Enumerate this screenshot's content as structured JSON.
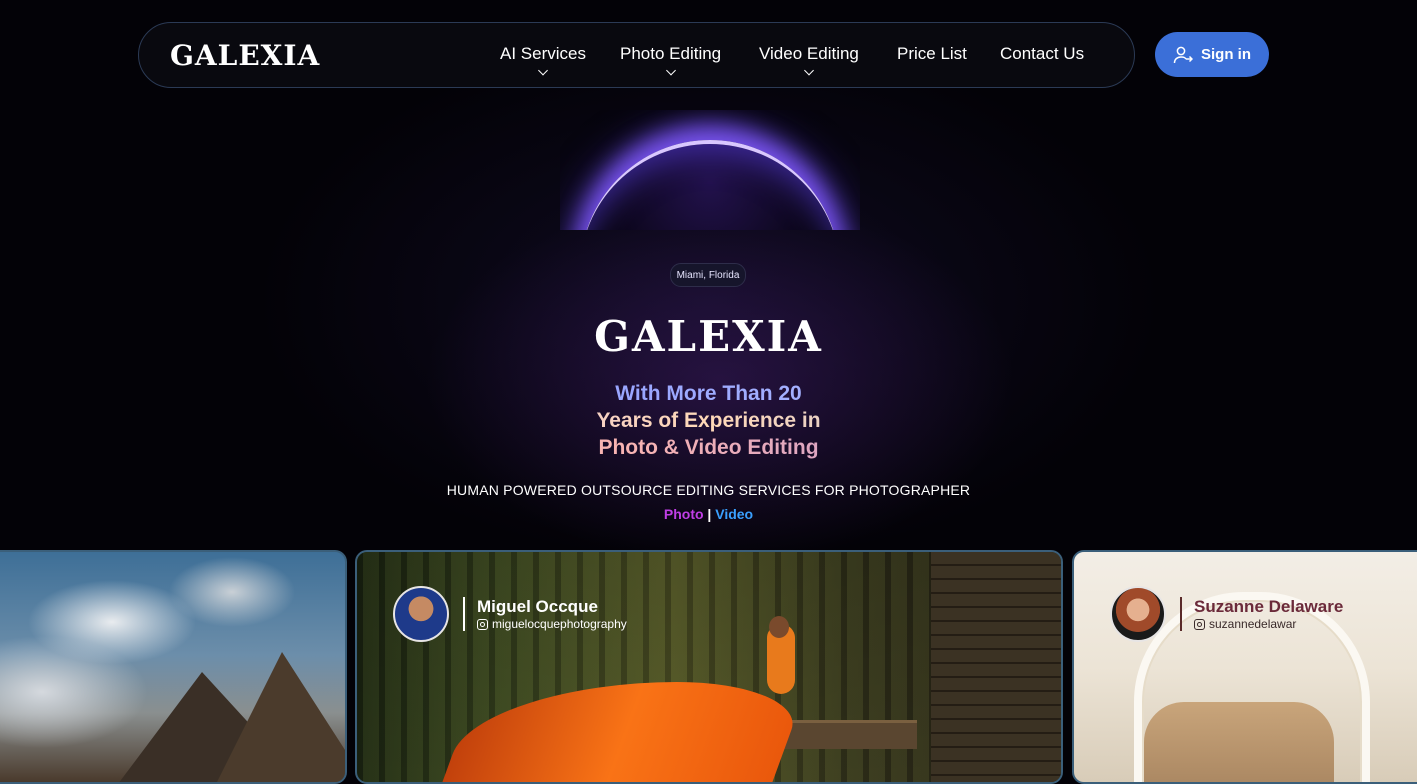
{
  "header": {
    "logo": "GALEXIA",
    "nav": [
      {
        "label": "AI Services",
        "has_dropdown": true
      },
      {
        "label": "Photo Editing",
        "has_dropdown": true
      },
      {
        "label": "Video Editing",
        "has_dropdown": true
      },
      {
        "label": "Price List",
        "has_dropdown": false
      },
      {
        "label": "Contact Us",
        "has_dropdown": false
      }
    ],
    "signin_label": "Sign in"
  },
  "hero": {
    "location_badge": "Miami, Florida",
    "brand": "GALEXIA",
    "headline_lines": [
      "With More Than 20",
      "Years of Experience in",
      "Photo & Video Editing"
    ],
    "subtitle": "HUMAN POWERED OUTSOURCE EDITING SERVICES FOR PHOTOGRAPHER",
    "photo_link": "Photo",
    "separator": "|",
    "video_link": "Video"
  },
  "showcase": [
    {
      "name": "",
      "handle": ""
    },
    {
      "name": "Miguel Occque",
      "handle": "miguelocquephotography"
    },
    {
      "name": "Suzanne Delaware",
      "handle": "suzannedelawar"
    }
  ],
  "colors": {
    "accent": "#3b6fd8",
    "photo_link": "#c03ee6",
    "video_link": "#3aa0ff",
    "background": "#030207"
  }
}
